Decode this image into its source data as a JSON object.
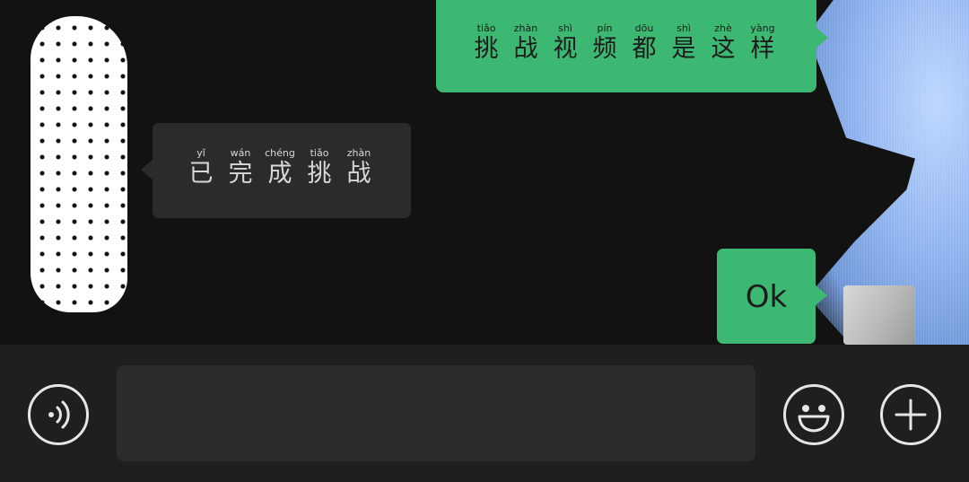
{
  "messages": [
    {
      "side": "right",
      "style": "green",
      "chars": [
        {
          "py": "tiǎo",
          "hz": "挑"
        },
        {
          "py": "zhàn",
          "hz": "战"
        },
        {
          "py": "shì",
          "hz": "视"
        },
        {
          "py": "pín",
          "hz": "频"
        },
        {
          "py": "dōu",
          "hz": "都"
        },
        {
          "py": "shì",
          "hz": "是"
        },
        {
          "py": "zhè",
          "hz": "这"
        },
        {
          "py": "yàng",
          "hz": "样"
        }
      ]
    },
    {
      "side": "left",
      "style": "dark",
      "chars": [
        {
          "py": "yǐ",
          "hz": "已"
        },
        {
          "py": "wán",
          "hz": "完"
        },
        {
          "py": "chéng",
          "hz": "成"
        },
        {
          "py": "tiǎo",
          "hz": "挑"
        },
        {
          "py": "zhàn",
          "hz": "战"
        }
      ]
    },
    {
      "side": "right",
      "style": "green",
      "text": "Ok"
    }
  ],
  "input_bar": {
    "voice_icon": "voice-icon",
    "emoji_icon": "emoji-icon",
    "plus_icon": "plus-icon",
    "text_value": "",
    "placeholder": ""
  },
  "colors": {
    "bubble_green": "#3db872",
    "bubble_dark": "#2b2b2b",
    "background": "#121212",
    "input_bar": "#1f1f1f"
  }
}
